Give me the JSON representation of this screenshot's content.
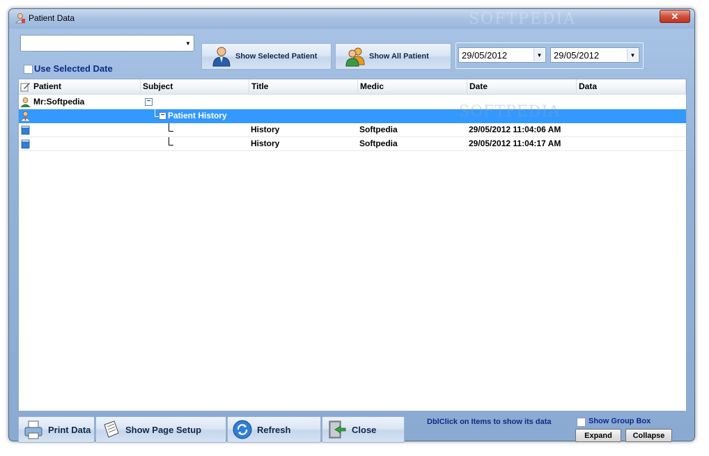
{
  "window": {
    "title": "Patient Data",
    "close_label": "✕",
    "watermark": "SOFTPEDIA"
  },
  "toolbar": {
    "patient_combo_value": "",
    "use_selected_date_label": "Use Selected Date",
    "show_selected_patient_label": "Show Selected Patient",
    "show_all_patient_label": "Show All Patient",
    "date_from": "29/05/2012",
    "date_to": "29/05/2012"
  },
  "grid": {
    "columns": [
      "Patient",
      "Subject",
      "Title",
      "Medic",
      "Date",
      "Data"
    ],
    "rows": [
      {
        "patient": "Mr:Softpedia",
        "subject": "",
        "title": "",
        "medic": "",
        "date": "",
        "data": ""
      },
      {
        "patient": "",
        "subject": "Patient History",
        "title": "",
        "medic": "",
        "date": "",
        "data": ""
      },
      {
        "patient": "",
        "subject": "",
        "title": "History",
        "medic": "Softpedia",
        "date": "29/05/2012 11:04:06 AM",
        "data": ""
      },
      {
        "patient": "",
        "subject": "",
        "title": "History",
        "medic": "Softpedia",
        "date": "29/05/2012 11:04:17 AM",
        "data": ""
      }
    ],
    "watermark": "SOFTPEDIA"
  },
  "footer": {
    "print_label": "Print Data",
    "page_setup_label": "Show Page Setup",
    "refresh_label": "Refresh",
    "close_label": "Close",
    "hint": "DblClick on Items to show its data",
    "show_group_box_label": "Show Group Box",
    "expand_label": "Expand",
    "collapse_label": "Collapse"
  },
  "colors": {
    "selection": "#3399ff",
    "label_text": "#0d2a8a",
    "window_bg": "#93b2d8"
  }
}
